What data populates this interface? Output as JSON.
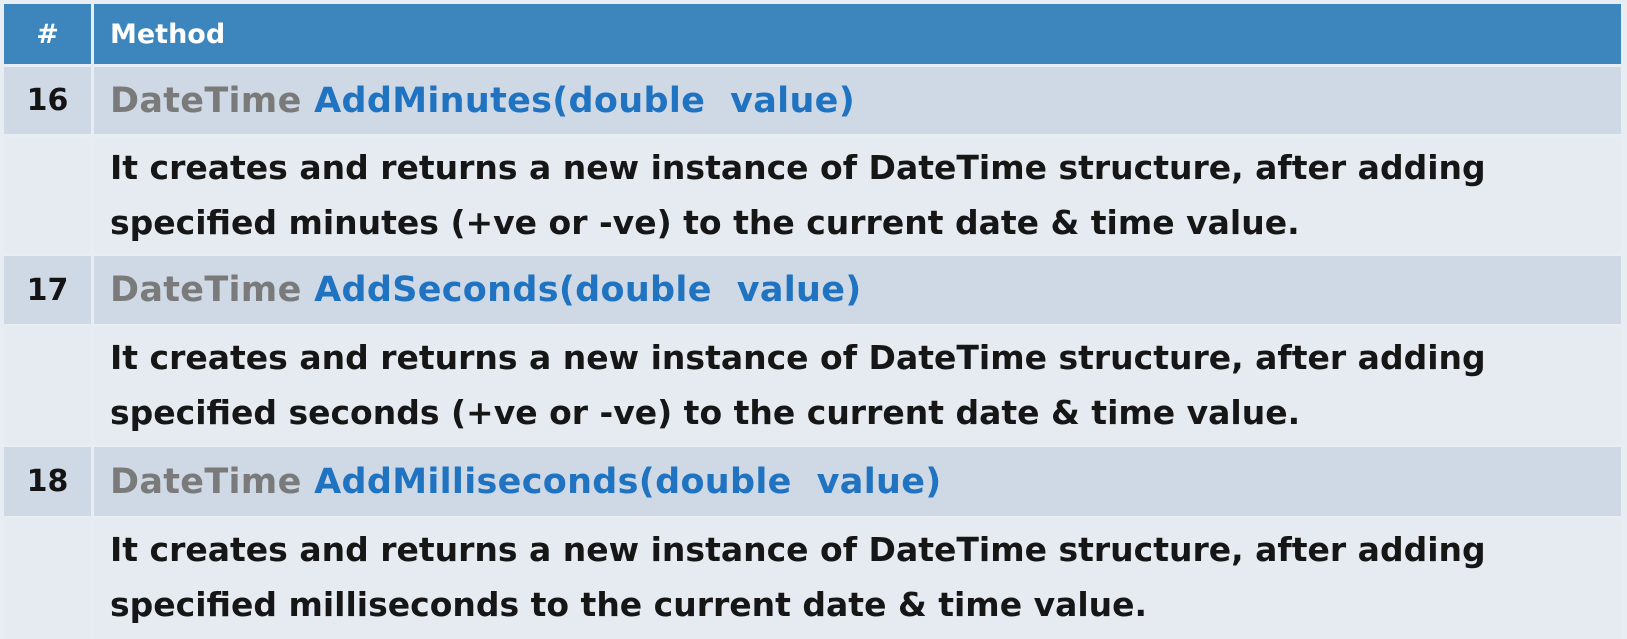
{
  "header": {
    "number": "#",
    "method": "Method"
  },
  "rows": [
    {
      "number": "16",
      "type": "DateTime",
      "signature": " AddMinutes(double  value)",
      "description": [
        "It creates and returns a new instance of DateTime structure, after adding",
        "specified minutes (+ve or -ve) to the current date & time value."
      ]
    },
    {
      "number": "17",
      "type": "DateTime",
      "signature": " AddSeconds(double  value)",
      "description": [
        "It creates and returns a new instance of DateTime structure, after adding",
        "specified seconds (+ve or -ve) to the current date & time value."
      ]
    },
    {
      "number": "18",
      "type": "DateTime",
      "signature": " AddMilliseconds(double  value)",
      "description": [
        "It creates and returns a new instance of DateTime structure, after adding",
        "specified milliseconds to the current date & time value."
      ]
    }
  ],
  "colors": {
    "header_bg": "#3c86bd",
    "signature_row_bg": "#cfd9e5",
    "description_row_bg": "#e6ebf1",
    "type_text": "#7a7a7a",
    "method_name_text": "#1f73c1"
  }
}
